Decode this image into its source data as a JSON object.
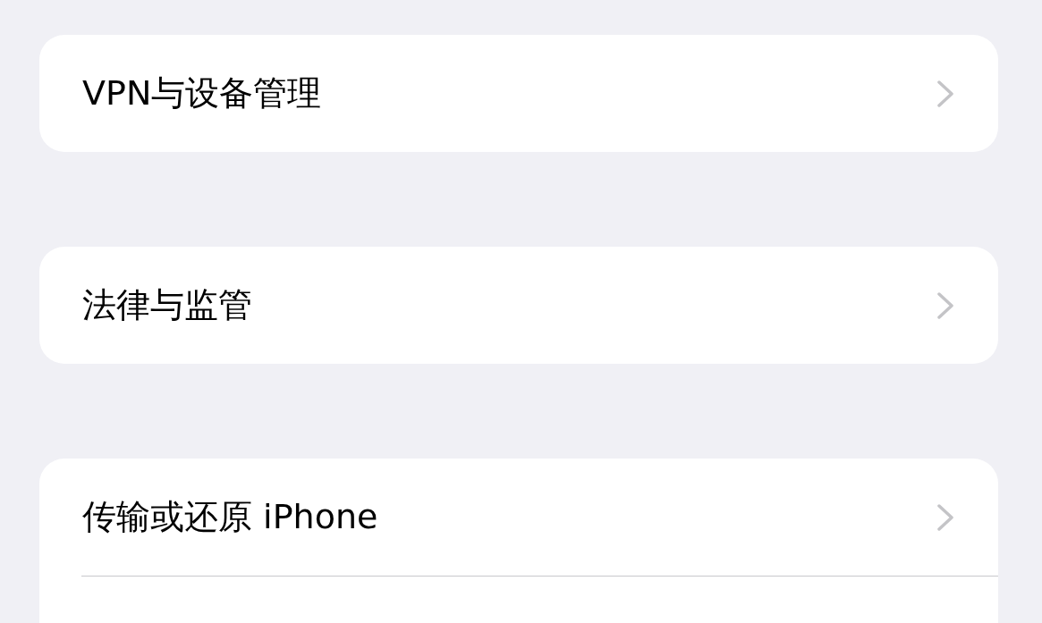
{
  "groups": [
    {
      "items": [
        {
          "label": "VPN与设备管理"
        }
      ],
      "continues_below": false
    },
    {
      "items": [
        {
          "label": "法律与监管"
        }
      ],
      "continues_below": false
    },
    {
      "items": [
        {
          "label": "传输或还原 iPhone"
        }
      ],
      "continues_below": true
    }
  ]
}
